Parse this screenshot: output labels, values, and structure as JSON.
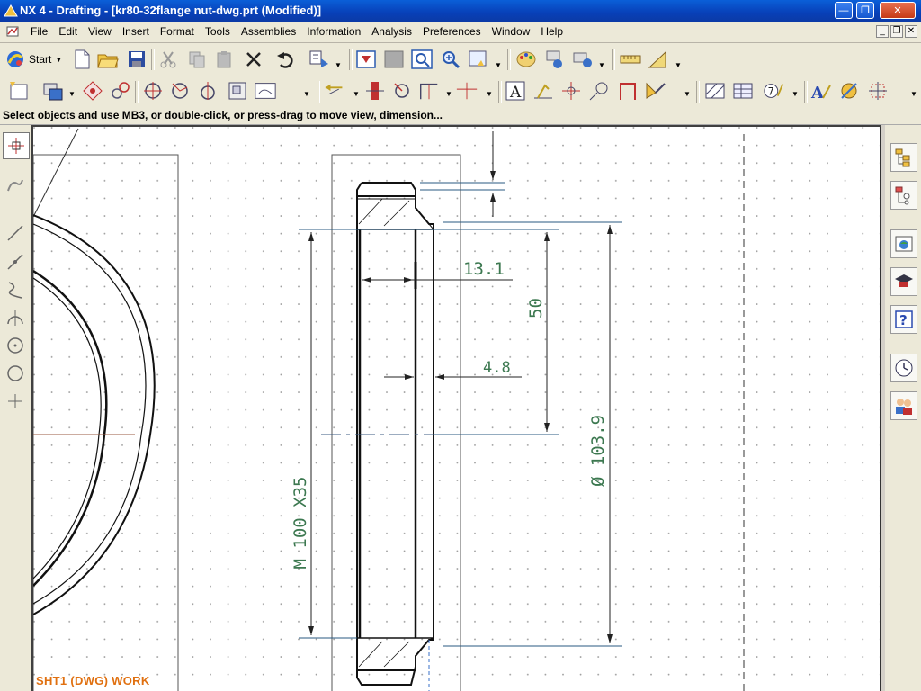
{
  "window": {
    "title": "NX 4 - Drafting - [kr80-32flange nut-dwg.prt (Modified)]"
  },
  "menu": {
    "items": [
      "File",
      "Edit",
      "View",
      "Insert",
      "Format",
      "Tools",
      "Assemblies",
      "Information",
      "Analysis",
      "Preferences",
      "Window",
      "Help"
    ]
  },
  "toolbar": {
    "start_label": "Start"
  },
  "status": {
    "message": "Select objects and use MB3, or double-click, or press-drag to move view, dimension..."
  },
  "drawing": {
    "dims": {
      "d1": "13.1",
      "d2": "50",
      "d3": "4.8",
      "d4": "M 100 X35",
      "d5": "Ø 103.9"
    },
    "sheet_label": "SHT1 (DWG) WORK"
  },
  "colors": {
    "accent": "#0a5fd8",
    "dimension": "#3c7850",
    "sheet_label": "#e07010"
  }
}
